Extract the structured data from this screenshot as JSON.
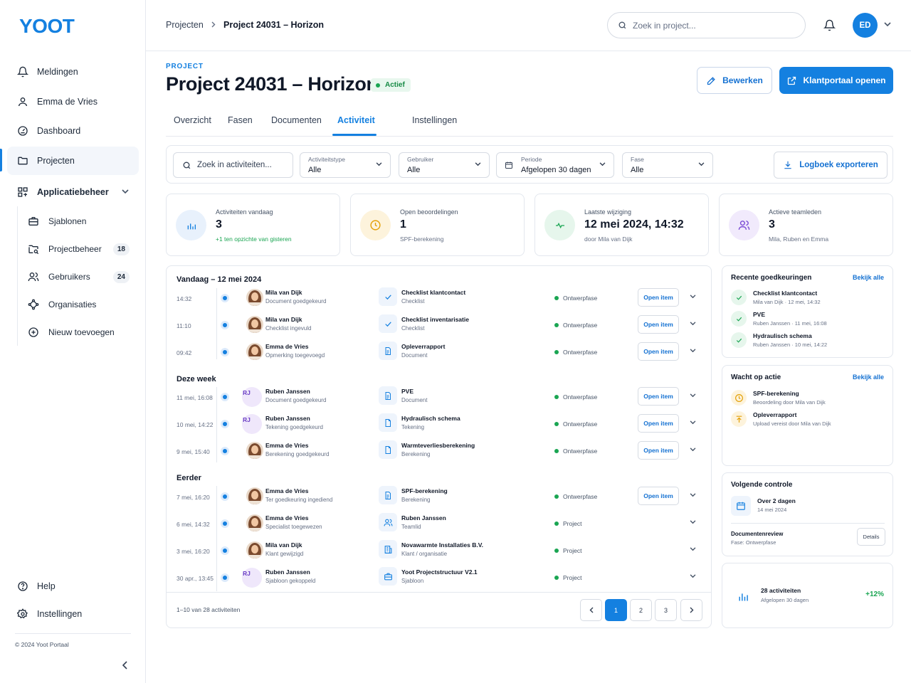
{
  "app": {
    "logo": "YOOT",
    "copyright": "© 2024 Yoot Portaal"
  },
  "sidebar": {
    "items": [
      {
        "label": "Meldingen",
        "icon": "bell-icon"
      },
      {
        "label": "Emma de Vries",
        "icon": "user-icon"
      },
      {
        "label": "Dashboard",
        "icon": "dashboard-icon"
      },
      {
        "label": "Projecten",
        "icon": "folder-icon"
      },
      {
        "label": "Applicatiebeheer",
        "icon": "grid-icon"
      }
    ],
    "subitems": [
      {
        "label": "Sjablonen",
        "icon": "briefcase-icon"
      },
      {
        "label": "Projectbeheer",
        "icon": "folder-search-icon",
        "badge": "18"
      },
      {
        "label": "Gebruikers",
        "icon": "users-icon",
        "badge": "24"
      },
      {
        "label": "Organisaties",
        "icon": "network-icon"
      },
      {
        "label": "Nieuw toevoegen",
        "icon": "plus-circle-icon"
      }
    ],
    "bottom": [
      {
        "label": "Help",
        "icon": "help-icon"
      },
      {
        "label": "Instellingen",
        "icon": "settings-icon"
      }
    ]
  },
  "topbar": {
    "breadcrumb": [
      "Projecten",
      "Project 24031 – Horizon"
    ],
    "search_placeholder": "Zoek in project...",
    "avatar_initials": "ED"
  },
  "header": {
    "eyebrow": "PROJECT",
    "title": "Project 24031 – Horizon",
    "status": "Actief",
    "edit_label": "Bewerken",
    "portal_label": "Klantportaal openen"
  },
  "tabs": [
    "Overzicht",
    "Fasen",
    "Documenten",
    "Activiteit",
    "Instellingen"
  ],
  "filters": {
    "search_placeholder": "Zoek in activiteiten...",
    "selects": [
      {
        "label": "Activiteitstype",
        "value": "Alle"
      },
      {
        "label": "Gebruiker",
        "value": "Alle"
      },
      {
        "label": "Periode",
        "value": "Afgelopen 30 dagen"
      },
      {
        "label": "Fase",
        "value": "Alle"
      }
    ],
    "export_label": "Logboek exporteren"
  },
  "stats": [
    {
      "label": "Activiteiten vandaag",
      "value": "3",
      "sub": "+1 ten opzichte van gisteren",
      "color": "#1480e0"
    },
    {
      "label": "Open beoordelingen",
      "value": "1",
      "sub": "SPF-berekening",
      "color": "#e3a008"
    },
    {
      "label": "Laatste wijziging",
      "value": "12 mei 2024, 14:32",
      "sub": "door Mila van Dijk",
      "color": "#1aa552"
    },
    {
      "label": "Actieve teamleden",
      "value": "3",
      "sub": "Mila, Ruben en Emma",
      "color": "#7c4dd6"
    }
  ],
  "feed": {
    "groups": [
      "Vandaag – 12 mei 2024",
      "Deze week",
      "Eerder"
    ],
    "open_label": "Open item",
    "rows": [
      {
        "time": "14:32",
        "user": "Mila van Dijk",
        "action": "Document goedgekeurd",
        "item": "Checklist klantcontact",
        "type": "Checklist",
        "phase": "Ontwerpfase",
        "open": true,
        "avatar": "photo",
        "icon": "check-icon"
      },
      {
        "time": "11:10",
        "user": "Mila van Dijk",
        "action": "Checklist ingevuld",
        "item": "Checklist inventarisatie",
        "type": "Checklist",
        "phase": "Ontwerpfase",
        "open": true,
        "avatar": "photo",
        "icon": "check-icon"
      },
      {
        "time": "09:42",
        "user": "Emma de Vries",
        "action": "Opmerking toegevoegd",
        "item": "Opleverrapport",
        "type": "Document",
        "phase": "Ontwerpfase",
        "open": true,
        "avatar": "photo",
        "icon": "document-icon"
      },
      {
        "time": "11 mei, 16:08",
        "user": "Ruben Janssen",
        "action": "Document goedgekeurd",
        "item": "PVE",
        "type": "Document",
        "phase": "Ontwerpfase",
        "open": true,
        "avatar": "RJ",
        "icon": "document-icon"
      },
      {
        "time": "10 mei, 14:22",
        "user": "Ruben Janssen",
        "action": "Tekening goedgekeurd",
        "item": "Hydraulisch schema",
        "type": "Tekening",
        "phase": "Ontwerpfase",
        "open": true,
        "avatar": "RJ",
        "icon": "file-icon"
      },
      {
        "time": "9 mei, 15:40",
        "user": "Emma de Vries",
        "action": "Berekening goedgekeurd",
        "item": "Warmteverliesberekening",
        "type": "Berekening",
        "phase": "Ontwerpfase",
        "open": true,
        "avatar": "photo",
        "icon": "file-icon"
      },
      {
        "time": "7 mei, 16:20",
        "user": "Emma de Vries",
        "action": "Ter goedkeuring ingediend",
        "item": "SPF-berekening",
        "type": "Berekening",
        "phase": "Ontwerpfase",
        "open": true,
        "avatar": "photo",
        "icon": "document-icon"
      },
      {
        "time": "6 mei, 14:32",
        "user": "Emma de Vries",
        "action": "Specialist toegewezen",
        "item": "Ruben Janssen",
        "type": "Teamlid",
        "phase": "Project",
        "open": false,
        "avatar": "photo",
        "icon": "users-icon"
      },
      {
        "time": "3 mei, 16:20",
        "user": "Mila van Dijk",
        "action": "Klant gewijzigd",
        "item": "Novawarmte Installaties B.V.",
        "type": "Klant / organisatie",
        "phase": "Project",
        "open": false,
        "avatar": "photo",
        "icon": "building-icon"
      },
      {
        "time": "30 apr., 13:45",
        "user": "Ruben Janssen",
        "action": "Sjabloon gekoppeld",
        "item": "Yoot Projectstructuur V2.1",
        "type": "Sjabloon",
        "phase": "Project",
        "open": false,
        "avatar": "RJ",
        "icon": "briefcase-icon"
      }
    ],
    "pagination_info": "1–10 van 28 activiteiten",
    "pages": [
      "1",
      "2",
      "3"
    ]
  },
  "approvals": {
    "title": "Recente goedkeuringen",
    "link": "Bekijk alle",
    "items": [
      {
        "title": "Checklist klantcontact",
        "meta": "Mila van Dijk · 12 mei, 14:32"
      },
      {
        "title": "PVE",
        "meta": "Ruben Janssen · 11 mei, 16:08"
      },
      {
        "title": "Hydraulisch schema",
        "meta": "Ruben Janssen · 10 mei, 14:22"
      }
    ]
  },
  "waiting": {
    "title": "Wacht op actie",
    "link": "Bekijk alle",
    "items": [
      {
        "title": "SPF-berekening",
        "meta": "Beoordeling door Mila van Dijk"
      },
      {
        "title": "Opleverrapport",
        "meta": "Upload vereist door Mila van Dijk"
      }
    ]
  },
  "next_control": {
    "title": "Volgende controle",
    "when": "Over 2 dagen",
    "date": "14 mei 2024",
    "doc": "Documentenreview",
    "phase": "Fase: Ontwerpfase",
    "details_label": "Details"
  },
  "summary": {
    "count": "28 activiteiten",
    "period": "Afgelopen 30 dagen",
    "change": "+12%"
  }
}
